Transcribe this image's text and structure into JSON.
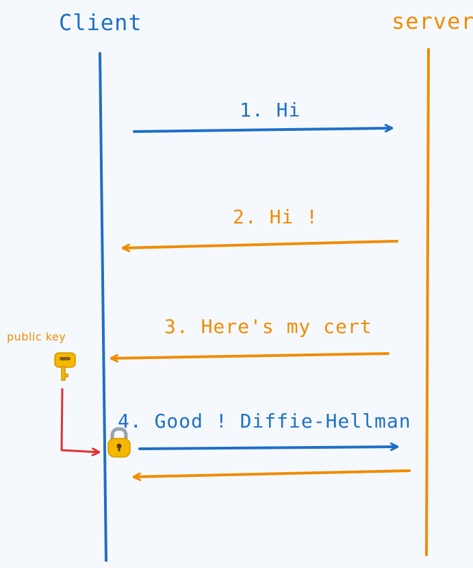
{
  "participants": {
    "client": "Client",
    "server": "server"
  },
  "messages": [
    {
      "label": "1. Hi",
      "direction": "client-to-server",
      "color": "#1f6fc6"
    },
    {
      "label": "2. Hi !",
      "direction": "server-to-client",
      "color": "#f08c00"
    },
    {
      "label": "3. Here's my cert",
      "direction": "server-to-client",
      "color": "#f08c00"
    },
    {
      "label": "4. Good ! Diffie-Hellman",
      "direction": "client-to-server",
      "color": "#1f6fc6"
    },
    {
      "label": "",
      "direction": "server-to-client",
      "color": "#f08c00"
    }
  ],
  "annotations": {
    "public_key": "public key",
    "key_icon": "key-icon",
    "lock_icon": "padlock-icon"
  },
  "colors": {
    "client": "#1f6fc6",
    "server": "#f08c00",
    "key_arrow": "#e03131",
    "background": "#f5f9fd"
  }
}
